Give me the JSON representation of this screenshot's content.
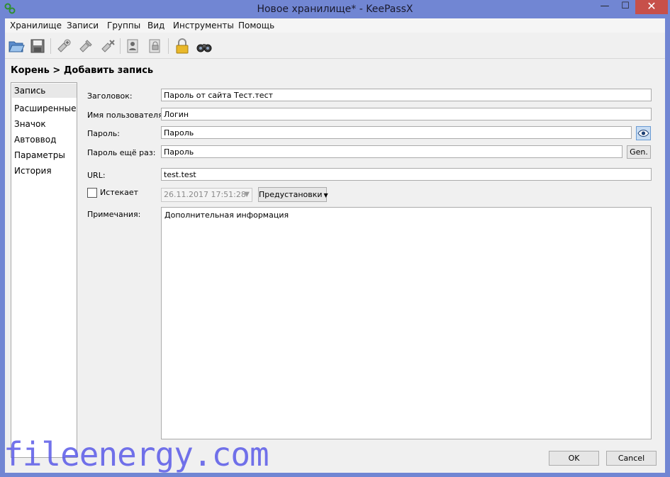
{
  "window": {
    "title": "Новое хранилище* - KeePassX",
    "minimize": "—",
    "maximize": "☐",
    "close": "✕"
  },
  "menu": [
    "Хранилище",
    "Записи",
    "Группы",
    "Вид",
    "Инструменты",
    "Помощь"
  ],
  "toolbar_icons": [
    "open-database-icon",
    "save-database-icon",
    "add-entry-icon",
    "edit-entry-icon",
    "delete-entry-icon",
    "copy-username-icon",
    "copy-password-icon",
    "lock-icon",
    "search-icon"
  ],
  "breadcrumb": "Корень > Добавить запись",
  "sidebar": [
    "Запись",
    "Расширенные",
    "Значок",
    "Автоввод",
    "Параметры",
    "История"
  ],
  "form": {
    "title_label": "Заголовок:",
    "title_value": "Пароль от сайта Тест.тест",
    "username_label": "Имя пользователя:",
    "username_value": "Логин",
    "password_label": "Пароль:",
    "password_value": "Пароль",
    "repeat_label": "Пароль ещё раз:",
    "repeat_value": "Пароль",
    "gen_label": "Gen.",
    "url_label": "URL:",
    "url_value": "test.test",
    "expires_label": "Истекает",
    "expires_checked": false,
    "expiry_date": "26.11.2017 17:51:28",
    "presets_label": "Предустановки",
    "notes_label": "Примечания:",
    "notes_value": "Дополнительная информация"
  },
  "footer": {
    "ok": "OK",
    "cancel": "Cancel"
  },
  "watermark": "fileenergy.com",
  "colors": {
    "titlebar": "#7186d3",
    "close": "#c7504a",
    "watermark": "#5a5ae8"
  }
}
